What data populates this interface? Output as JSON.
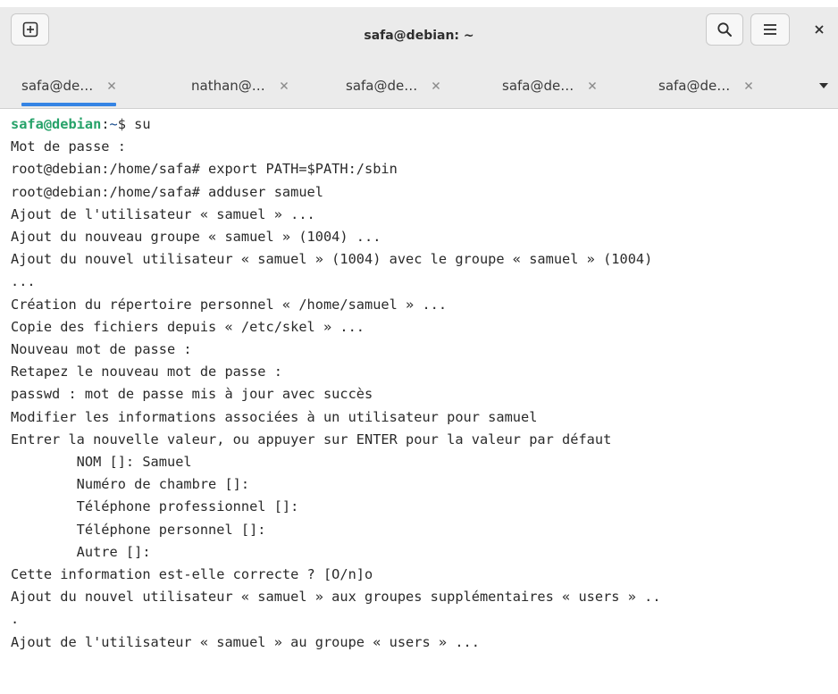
{
  "window": {
    "title": "safa@debian: ~"
  },
  "tabs": [
    {
      "label": "safa@de…",
      "active": true
    },
    {
      "label": "nathan@…",
      "active": false
    },
    {
      "label": "safa@de…",
      "active": false
    },
    {
      "label": "safa@de…",
      "active": false
    },
    {
      "label": "safa@de…",
      "active": false
    }
  ],
  "icons": {
    "new_tab": "new-tab-plus-icon",
    "search": "search-icon",
    "menu": "hamburger-menu-icon",
    "close": "close-icon",
    "tab_close": "close-icon",
    "tab_dropdown": "caret-down-icon"
  },
  "colors": {
    "prompt_user": "#26a269",
    "prompt_path": "#12488b",
    "active_tab_indicator": "#3584e4",
    "text": "#2a2a2a"
  },
  "terminal": {
    "prompt": {
      "user_host": "safa@debian",
      "colon": ":",
      "path": "~",
      "symbol": "$ ",
      "command": "su"
    },
    "lines": [
      "Mot de passe :",
      "root@debian:/home/safa# export PATH=$PATH:/sbin",
      "root@debian:/home/safa# adduser samuel",
      "Ajout de l'utilisateur « samuel » ...",
      "Ajout du nouveau groupe « samuel » (1004) ...",
      "Ajout du nouvel utilisateur « samuel » (1004) avec le groupe « samuel » (1004)",
      "...",
      "Création du répertoire personnel « /home/samuel » ...",
      "Copie des fichiers depuis « /etc/skel » ...",
      "Nouveau mot de passe :",
      "Retapez le nouveau mot de passe :",
      "passwd : mot de passe mis à jour avec succès",
      "Modifier les informations associées à un utilisateur pour samuel",
      "Entrer la nouvelle valeur, ou appuyer sur ENTER pour la valeur par défaut",
      "        NOM []: Samuel",
      "        Numéro de chambre []:",
      "        Téléphone professionnel []:",
      "        Téléphone personnel []:",
      "        Autre []:",
      "Cette information est-elle correcte ? [O/n]o",
      "Ajout du nouvel utilisateur « samuel » aux groupes supplémentaires « users » ..",
      ".",
      "Ajout de l'utilisateur « samuel » au groupe « users » ..."
    ]
  }
}
